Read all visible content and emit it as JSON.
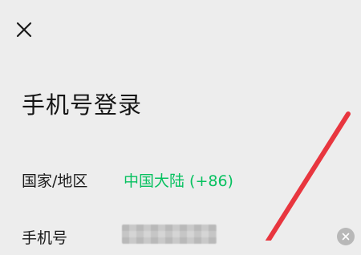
{
  "icons": {
    "close": "close-icon",
    "clear": "clear-icon"
  },
  "page_title": "手机号登录",
  "region": {
    "label": "国家/地区",
    "value": "中国大陆 (+86)"
  },
  "phone": {
    "label": "手机号",
    "value": ""
  },
  "colors": {
    "accent": "#07c160",
    "background": "#ededed",
    "annotation": "#e8363f"
  }
}
